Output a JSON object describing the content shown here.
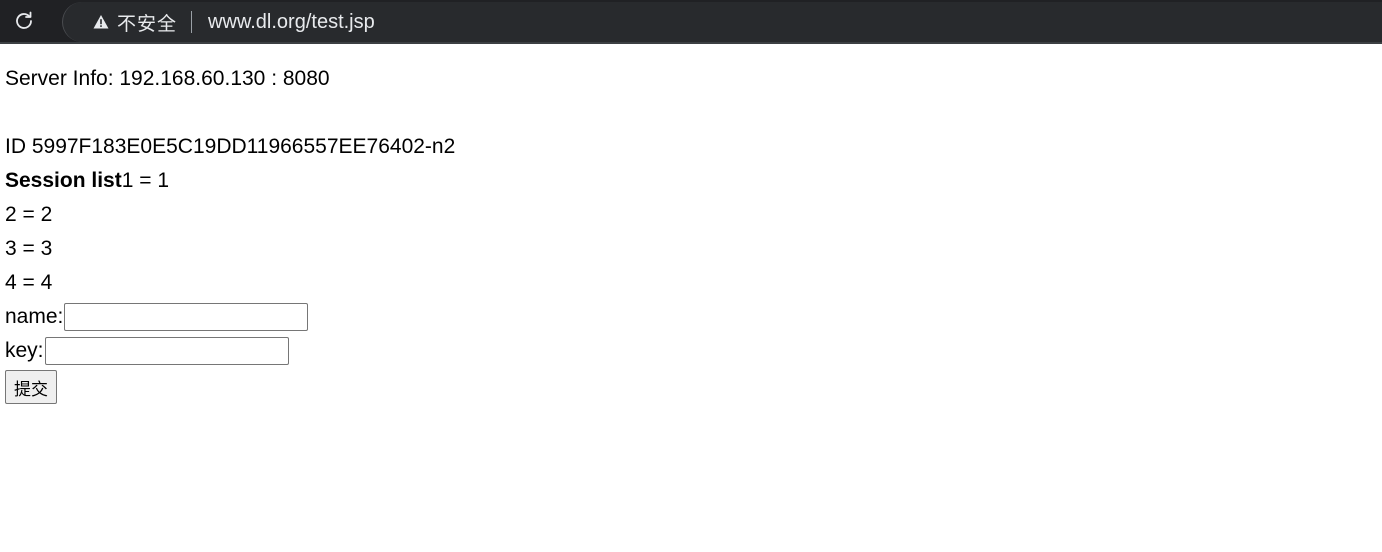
{
  "browser": {
    "security_text": "不安全",
    "url": "www.dl.org/test.jsp",
    "icons": {
      "reload": "reload-icon",
      "warning": "warning-icon"
    },
    "colors": {
      "toolbar_bg": "#202124",
      "text": "#e8eaed"
    }
  },
  "page": {
    "server_info": "Server Info: 192.168.60.130 : 8080",
    "session_id": "ID 5997F183E0E5C19DD11966557EE76402-n2",
    "session_list_title": "Session list",
    "session_items": [
      "1 = 1",
      "2 = 2",
      "3 = 3",
      "4 = 4"
    ],
    "form": {
      "name_label": "name:",
      "name_value": "",
      "key_label": "key:",
      "key_value": "",
      "submit_label": "提交"
    }
  }
}
